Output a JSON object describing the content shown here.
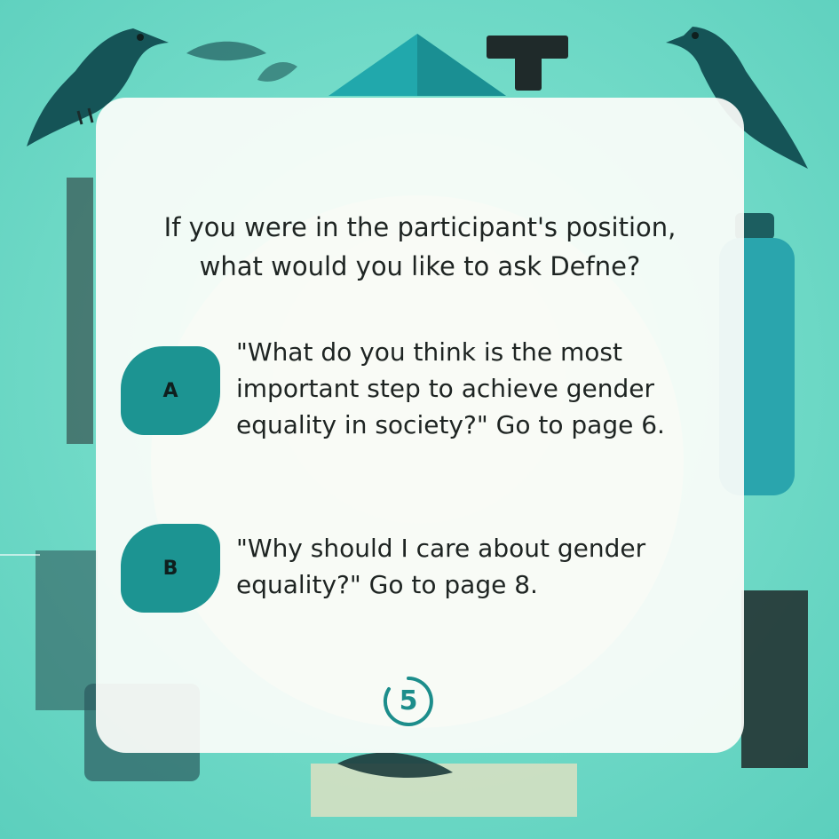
{
  "question": {
    "line1": "If you were in the participant's position,",
    "line2": "what would you like to ask Defne?"
  },
  "options": [
    {
      "letter": "A",
      "lines": [
        "\"What do you think is the most",
        "important step to achieve gender",
        "equality in society?\" Go to page 6."
      ]
    },
    {
      "letter": "B",
      "lines": [
        "\"Why should I care about gender",
        "equality?\" Go to page 8."
      ]
    }
  ],
  "page_number": "5",
  "colors": {
    "accent": "#1c9492",
    "background": "#66d6c4",
    "card": "#fdfdfa",
    "text": "#1e2422"
  },
  "icons": [
    "crow-left-icon",
    "crow-right-icon",
    "bottle-icon",
    "triangle-icon",
    "page-ring-icon"
  ]
}
